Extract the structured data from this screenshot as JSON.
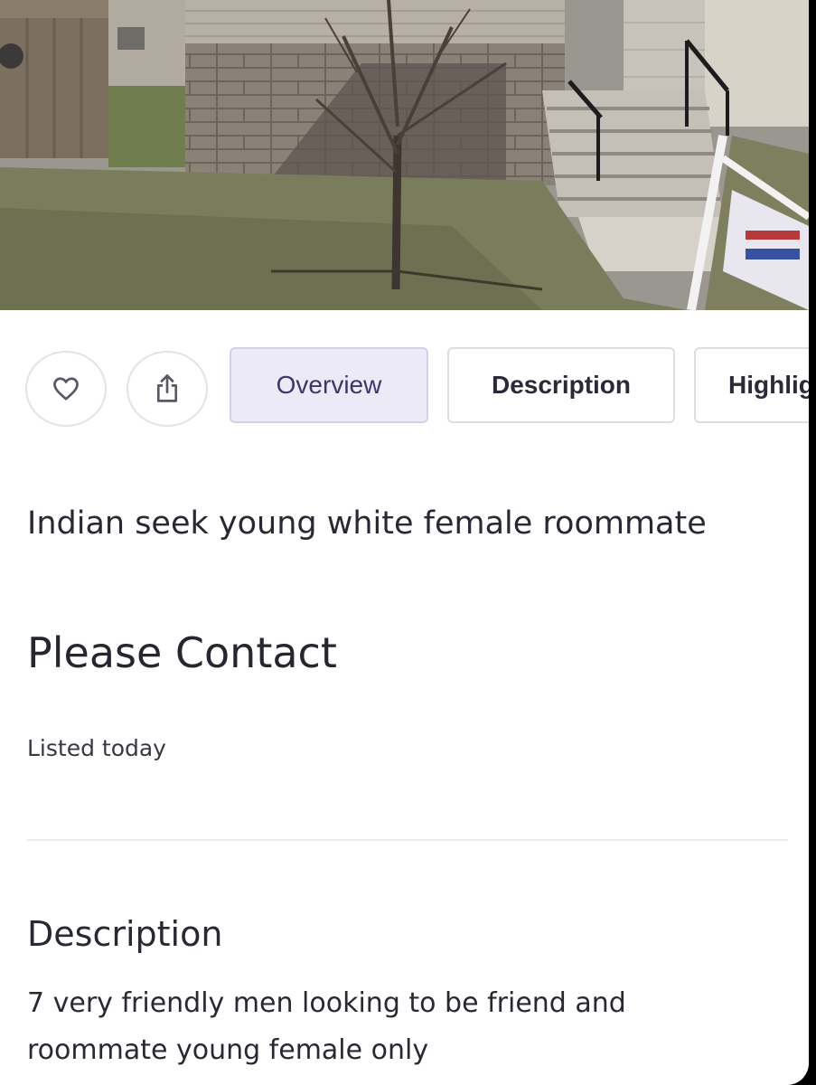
{
  "listing": {
    "image": "house-front-photo",
    "actions": {
      "favorite_icon": "heart-icon",
      "share_icon": "share-icon"
    },
    "tabs": [
      {
        "label": "Overview",
        "active": true
      },
      {
        "label": "Description",
        "active": false
      },
      {
        "label": "Highlig",
        "active": false
      }
    ],
    "title": "Indian seek young white female roommate",
    "price_text": "Please Contact",
    "listed": "Listed today",
    "description_heading": "Description",
    "description_body": "7 very friendly men looking to be friend and roommate young female only"
  },
  "colors": {
    "active_tab_bg": "#eceaf6",
    "text": "#2b2833",
    "border": "#dddde3"
  }
}
